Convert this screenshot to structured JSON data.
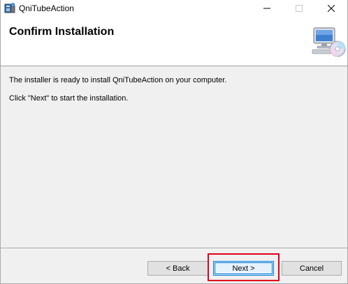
{
  "window": {
    "title": "QniTubeAction"
  },
  "banner": {
    "title": "Confirm Installation",
    "icon": "computer-disc-icon"
  },
  "body": {
    "line1": "The installer is ready to install QniTubeAction on your computer.",
    "line2": "Click \"Next\" to start the installation."
  },
  "buttons": {
    "back": "< Back",
    "next": "Next >",
    "cancel": "Cancel"
  },
  "colors": {
    "highlight": "#e0001a",
    "focus": "#0078d7"
  }
}
